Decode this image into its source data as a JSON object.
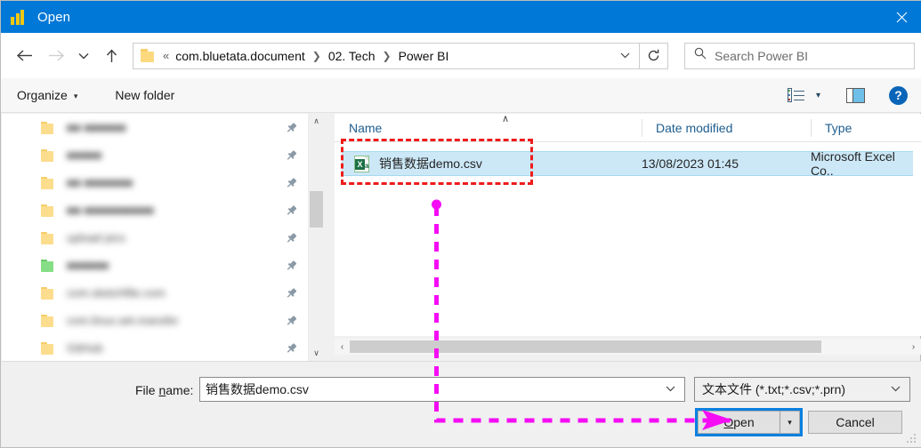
{
  "window": {
    "title": "Open",
    "app_icon": "powerbi-icon",
    "close_label": "×",
    "titlebar_color": "#0078D7"
  },
  "nav": {
    "back": "←",
    "forward": "→",
    "recent": "∨",
    "up": "↑",
    "refresh": "↻"
  },
  "address": {
    "leading_separator": "«",
    "crumbs": [
      "com.bluetata.document",
      "02. Tech",
      "Power BI"
    ],
    "separator": "❯",
    "dropdown": "⌄"
  },
  "search": {
    "placeholder": "Search Power BI",
    "icon": "search-icon"
  },
  "commandbar": {
    "organize": "Organize",
    "organize_caret": "▾",
    "new_folder": "New folder",
    "view_caret": "▾",
    "help": "?"
  },
  "sidebar": {
    "items": [
      {
        "label": "■■ ■■■■■■",
        "color": "yellow",
        "pinned": true
      },
      {
        "label": "■■■■■",
        "color": "yellow",
        "pinned": true
      },
      {
        "label": "■■ ■■■■■■■",
        "color": "yellow",
        "pinned": true
      },
      {
        "label": "■■ ■■■■■■■■■■",
        "color": "yellow",
        "pinned": true
      },
      {
        "label": "upload pics",
        "color": "yellow",
        "pinned": true
      },
      {
        "label": "■■■■■■",
        "color": "green",
        "pinned": true
      },
      {
        "label": "com.sketchfile.com",
        "color": "yellow",
        "pinned": true
      },
      {
        "label": "com.linux.win.transfer",
        "color": "yellow",
        "pinned": true
      },
      {
        "label": "GitHub",
        "color": "yellow",
        "pinned": true
      }
    ],
    "pin_icon": "pin-icon",
    "scroll_up": "∧",
    "scroll_down": "∨"
  },
  "filelist": {
    "columns": [
      "Name",
      "Date modified",
      "Type"
    ],
    "sort_indicator": "∧",
    "rows": [
      {
        "name": "销售数据demo.csv",
        "date_modified": "13/08/2023 01:45",
        "type": "Microsoft Excel Co..",
        "icon": "csv-excel-icon",
        "selected": true
      }
    ],
    "hscroll_left": "‹",
    "hscroll_right": "›"
  },
  "bottom": {
    "filename_label_pre": "File ",
    "filename_label_key": "n",
    "filename_label_post": "ame:",
    "filename_value": "销售数据demo.csv",
    "filetype_value": "文本文件 (*.txt;*.csv;*.prn)",
    "dropdown_caret": "⌄",
    "open_label_pre": "",
    "open_label_key": "O",
    "open_label_post": "pen",
    "open_split_caret": "▾",
    "cancel_label": "Cancel"
  },
  "annotations": {
    "highlight_box_color": "#EE1C1C",
    "arrow_color": "#F50CF5",
    "open_focus_color": "#0A80E0"
  }
}
